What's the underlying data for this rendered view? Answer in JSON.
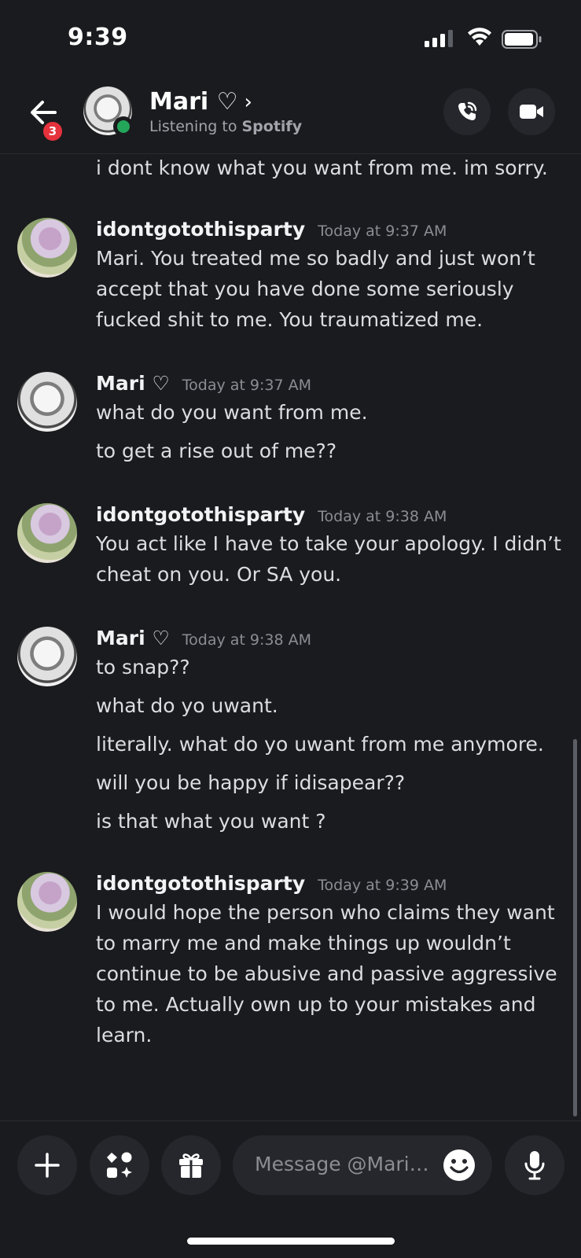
{
  "status_bar": {
    "time": "9:39"
  },
  "header": {
    "back_badge": "3",
    "name": "Mari ♡",
    "chevron": "›",
    "status_prefix": "Listening to",
    "status_app": "Spotify"
  },
  "messages": {
    "continuation": "i dont know what you want from me. im sorry.",
    "groups": [
      {
        "author": "idontgotothisparty",
        "time": "Today at 9:37 AM",
        "lines": [
          "Mari. You treated me so badly and just won’t",
          "accept that you have done some seriously",
          "fucked shit to me. You traumatized me."
        ]
      },
      {
        "author": "Mari ♡",
        "time": "Today at 9:37 AM",
        "lines": [
          "what do you want from me.",
          "to get a rise out of me??"
        ]
      },
      {
        "author": "idontgotothisparty",
        "time": "Today at 9:38 AM",
        "lines": [
          "You act like I have to take your apology. I didn’t",
          "cheat on you. Or SA you."
        ]
      },
      {
        "author": "Mari ♡",
        "time": "Today at 9:38 AM",
        "lines": [
          "to snap??",
          "what do yo uwant.",
          "literally. what do yo uwant from me anymore.",
          "will you be happy if idisapear??",
          "is that what you want ?"
        ]
      },
      {
        "author": "idontgotothisparty",
        "time": "Today at 9:39 AM",
        "lines": [
          "I would hope the person who claims they want",
          "to marry me and make things up wouldn’t",
          "continue to be abusive and passive aggressive",
          "to me. Actually own up to your mistakes and",
          "learn."
        ]
      }
    ]
  },
  "composer": {
    "placeholder": "Message @Mari…"
  },
  "icons": {
    "back": "arrow-left-icon",
    "call": "phone-icon",
    "video": "video-camera-icon",
    "add": "plus-icon",
    "apps": "apps-icon",
    "gift": "gift-icon",
    "emoji": "emoji-icon",
    "mic": "microphone-icon"
  },
  "colors": {
    "background": "#1a1b1e",
    "online": "#23a55a",
    "badge": "#e5323c"
  }
}
